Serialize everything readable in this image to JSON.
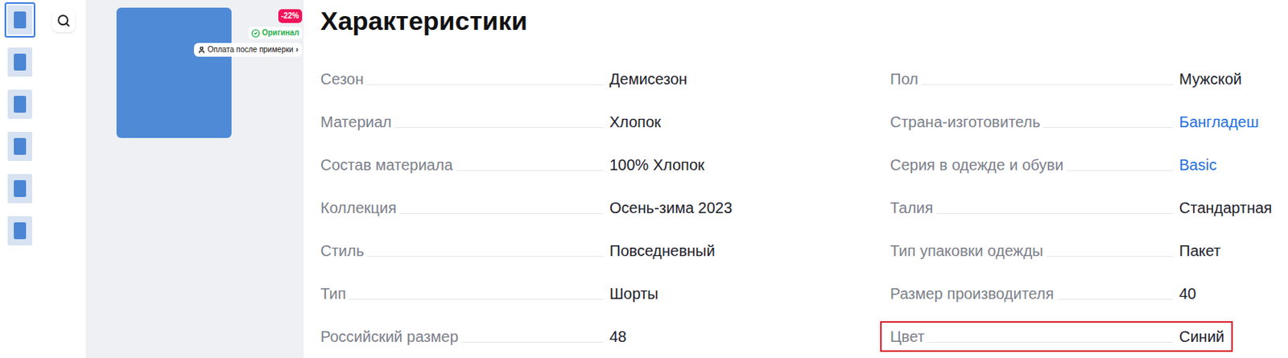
{
  "gallery": {
    "thumbnails": [
      {
        "selected": true
      },
      {
        "selected": false
      },
      {
        "selected": false
      },
      {
        "selected": false
      },
      {
        "selected": false
      },
      {
        "selected": false
      }
    ],
    "badges": {
      "discount": "-22%",
      "original": "Оригинал",
      "payment": "Оплата после примерки",
      "payment_arrow": "›"
    }
  },
  "characteristics": {
    "title": "Характеристики",
    "columns": [
      [
        {
          "label": "Сезон",
          "value": "Демисезон",
          "link": false,
          "highlighted": false
        },
        {
          "label": "Материал",
          "value": "Хлопок",
          "link": false,
          "highlighted": false
        },
        {
          "label": "Состав материала",
          "value": "100% Хлопок",
          "link": false,
          "highlighted": false
        },
        {
          "label": "Коллекция",
          "value": "Осень-зима 2023",
          "link": false,
          "highlighted": false
        },
        {
          "label": "Стиль",
          "value": "Повседневный",
          "link": false,
          "highlighted": false
        },
        {
          "label": "Тип",
          "value": "Шорты",
          "link": false,
          "highlighted": false
        },
        {
          "label": "Российский размер",
          "value": "48",
          "link": false,
          "highlighted": false
        }
      ],
      [
        {
          "label": "Пол",
          "value": "Мужской",
          "link": false,
          "highlighted": false
        },
        {
          "label": "Страна-изготовитель",
          "value": "Бангладеш",
          "link": true,
          "highlighted": false
        },
        {
          "label": "Серия в одежде и обуви",
          "value": "Basic",
          "link": true,
          "highlighted": false
        },
        {
          "label": "Талия",
          "value": "Стандартная",
          "link": false,
          "highlighted": false
        },
        {
          "label": "Тип упаковки одежды",
          "value": "Пакет",
          "link": false,
          "highlighted": false
        },
        {
          "label": "Размер производителя",
          "value": "40",
          "link": false,
          "highlighted": false
        },
        {
          "label": "Цвет",
          "value": "Синий",
          "link": false,
          "highlighted": true
        }
      ]
    ]
  }
}
